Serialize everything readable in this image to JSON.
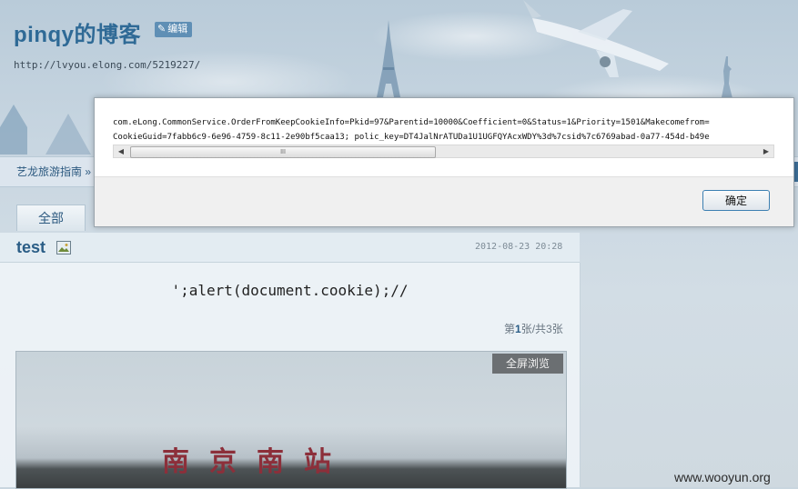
{
  "blog": {
    "title": "pinqy的博客",
    "edit_label": "编辑",
    "url": "http://lvyou.elong.com/5219227/"
  },
  "breadcrumb": {
    "text": "艺龙旅游指南 »"
  },
  "tabs": {
    "all_label": "全部"
  },
  "post": {
    "title": "test",
    "date": "2012-08-23 20:28",
    "text": "';alert(document.cookie);//",
    "page_prefix": "第",
    "page_current": "1",
    "page_suffix": "张/共3张",
    "fullscreen_label": "全屏浏览",
    "image_sign": "南京南站"
  },
  "dialog": {
    "message_line1": "com.eLong.CommonService.OrderFromKeepCookieInfo=Pkid=97&Parentid=10000&Coefficient=0&Status=1&Priority=1501&Makecomefrom=",
    "message_line2": "CookieGuid=7fabb6c9-6e96-4759-8c11-2e90bf5caa13; polic_key=DT4JalNrATUDa1U1UGFQYAcxWDY%3d%7csid%7c6769abad-0a77-454d-b49e",
    "scroll_grip": "III",
    "ok_label": "确定"
  },
  "watermark": "www.wooyun.org",
  "colors": {
    "accent": "#2f6a96",
    "dialog_button_border": "#3c7fb1"
  }
}
